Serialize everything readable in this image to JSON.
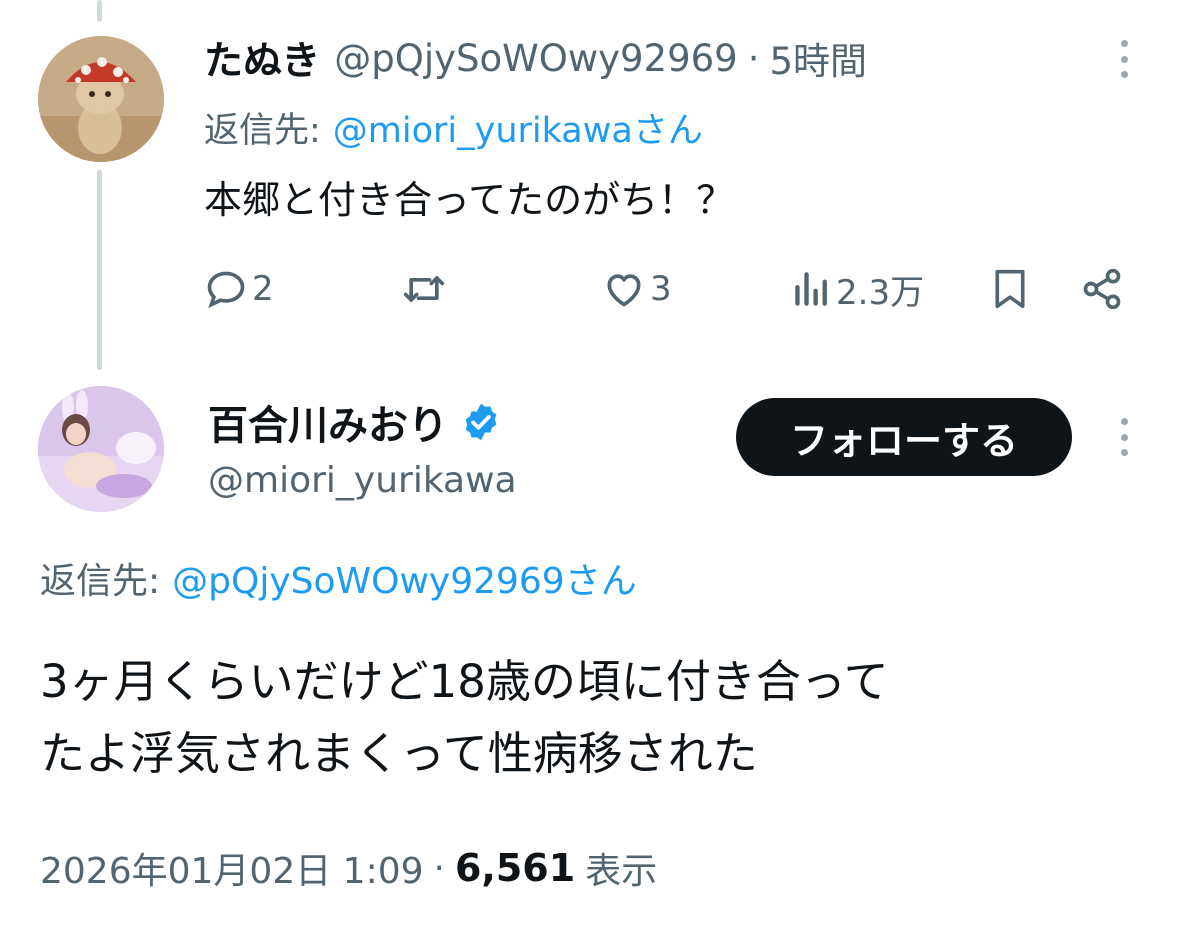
{
  "reply_tweet": {
    "display_name": "たぬき",
    "handle": "@pQjySoWOwy92969",
    "separator": "·",
    "time": "5時間",
    "reply_prefix": "返信先:",
    "reply_to": "@miori_yurikawaさん",
    "text": "本郷と付き合ってたのがち！？",
    "actions": {
      "reply_count": "2",
      "retweet_count": "",
      "like_count": "3",
      "views_count": "2.3万"
    }
  },
  "main_tweet": {
    "display_name": "百合川みおり",
    "verified": true,
    "handle": "@miori_yurikawa",
    "follow_label": "フォローする",
    "reply_prefix": "返信先:",
    "reply_to": "@pQjySoWOwy92969さん",
    "text_line1": "3ヶ月くらいだけど18歳の頃に付き合って",
    "text_line2": "たよ浮気されまくって性病移された",
    "timestamp": "2026年01月02日 1:09",
    "separator": "·",
    "views": "6,561",
    "views_label": "表示"
  },
  "colors": {
    "accent": "#1d9bf0",
    "muted": "#536471",
    "text": "#0f1419",
    "thread_line": "#cfd9de"
  }
}
